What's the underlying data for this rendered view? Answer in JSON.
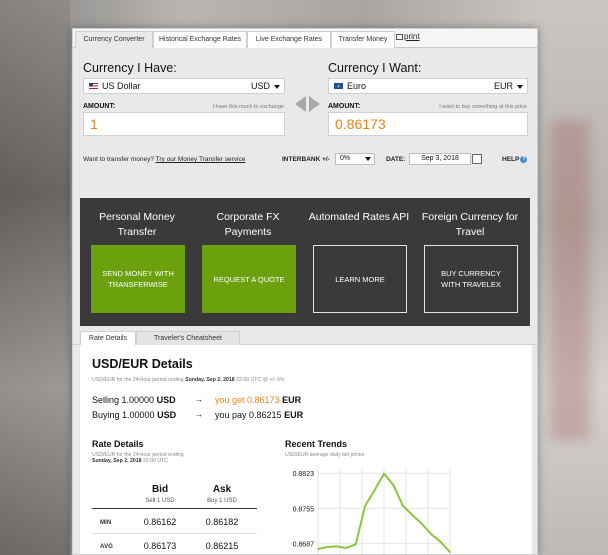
{
  "tabs": {
    "items": [
      "Currency Converter",
      "Historical Exchange Rates",
      "Live Exchange Rates",
      "Transfer Money"
    ],
    "print": "print"
  },
  "converter": {
    "have_label": "Currency I Have:",
    "want_label": "Currency I Want:",
    "have_currency": {
      "name": "US Dollar",
      "code": "USD"
    },
    "want_currency": {
      "name": "Euro",
      "code": "EUR"
    },
    "amount_label": "AMOUNT:",
    "have_hint": "I have this much to exchange",
    "want_hint": "I want to buy something at this price",
    "have_amount": "1",
    "want_amount": "0.86173",
    "transfer_prompt": "Want to transfer money?",
    "transfer_link": "Try our Money Transfer service",
    "interbank_label": "INTERBANK +/-",
    "interbank_value": "0%",
    "date_label": "DATE:",
    "date_value": "Sep 3, 2018",
    "help": "HELP"
  },
  "promo": [
    {
      "title": "Personal Money Transfer",
      "button": "SEND MONEY WITH TRANSFERWISE"
    },
    {
      "title": "Corporate FX Payments",
      "button": "REQUEST A QUOTE"
    },
    {
      "title": "Automated Rates API",
      "button": "LEARN MORE"
    },
    {
      "title": "Foreign Currency for Travel",
      "button": "BUY CURRENCY WITH TRAVELEX"
    }
  ],
  "subtabs": [
    "Rate Details",
    "Traveler's Cheatsheet"
  ],
  "details": {
    "title": "USD/EUR Details",
    "period_prefix": "USD/EUR for the 24-hour period ending",
    "period_date": "Sunday, Sep 2, 2018",
    "period_suffix": "22:00 UTC @ +/- 0%",
    "sell_prefix": "Selling 1.00000",
    "sell_code": "USD",
    "sell_result": "you get 0.86173",
    "sell_result_code": "EUR",
    "buy_prefix": "Buying 1.00000",
    "buy_code": "USD",
    "buy_result": "you pay 0.86215",
    "buy_result_code": "EUR"
  },
  "rate_details": {
    "title": "Rate Details",
    "sub_prefix": "USD/EUR for the 24-hour period ending",
    "sub_date": "Sunday, Sep 2, 2018",
    "sub_time": "22:00 UTC",
    "col_bid": "Bid",
    "col_ask": "Ask",
    "bid_sub": "Sell 1 USD",
    "ask_sub": "Buy 1 USD",
    "rows": [
      {
        "label": "MIN",
        "bid": "0.86162",
        "ask": "0.86182"
      },
      {
        "label": "AVG",
        "bid": "0.86173",
        "ask": "0.86215"
      }
    ]
  },
  "trends": {
    "title": "Recent Trends",
    "subtitle": "USD/EUR average daily bid prices"
  },
  "chart_data": {
    "type": "line",
    "title": "Recent Trends",
    "subtitle": "USD/EUR average daily bid prices",
    "y_ticks": [
      "0.8823",
      "0.8755",
      "0.8687"
    ],
    "ylim": [
      0.8645,
      0.8835
    ],
    "x": [
      0,
      1,
      2,
      3,
      4,
      5,
      6,
      7,
      8,
      9,
      10,
      11,
      12,
      13,
      14
    ],
    "values": [
      0.8676,
      0.868,
      0.8681,
      0.8678,
      0.8685,
      0.876,
      0.879,
      0.8822,
      0.88,
      0.876,
      0.8742,
      0.8725,
      0.8705,
      0.869,
      0.867
    ],
    "grid": true,
    "color": "#8cc63f"
  },
  "colors": {
    "accent_orange": "#e8841a",
    "promo_green": "#6aa10d",
    "promo_bg": "#3a3a3a"
  }
}
